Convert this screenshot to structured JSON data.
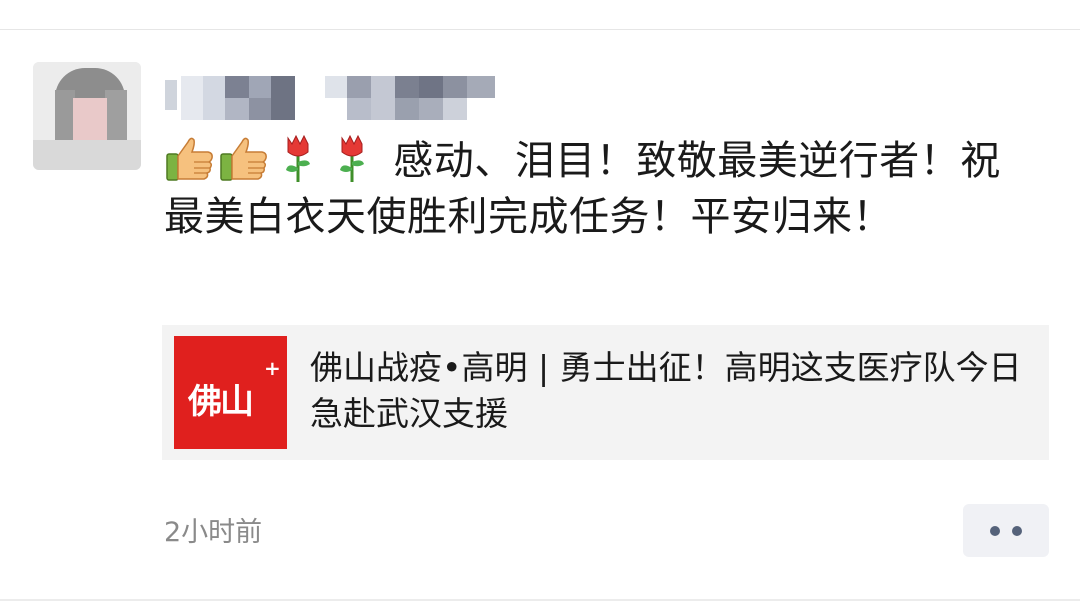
{
  "post": {
    "username": "",
    "text": "感动、泪目！致敬最美逆行者！祝最美白衣天使胜利完成任务！平安归来！",
    "emojis": [
      "thumbs-up-icon",
      "thumbs-up-icon",
      "rose-icon",
      "rose-icon"
    ],
    "timestamp": "2小时前"
  },
  "link_card": {
    "thumb_text": "佛山",
    "thumb_mark": "+",
    "title": "佛山战疫•高明 | 勇士出征！高明这支医疗队今日急赴武汉支援"
  },
  "colors": {
    "thumb_background": "#e0201e",
    "card_background": "#f3f3f3",
    "timestamp": "#8a8a8a",
    "more_dots": "#55627a"
  }
}
